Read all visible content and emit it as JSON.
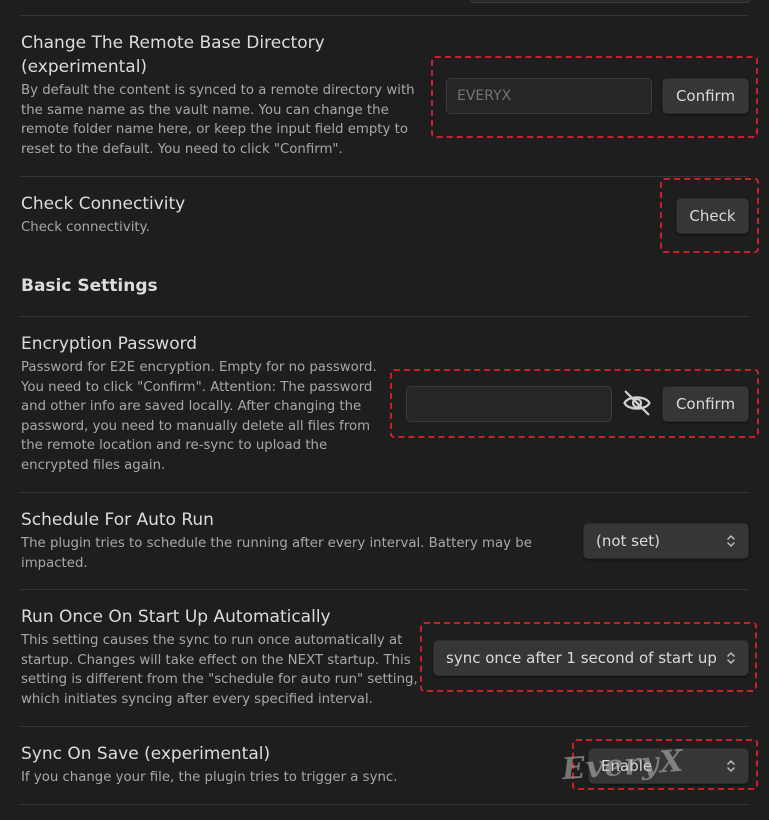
{
  "remote_dir": {
    "title_line1": "Change The Remote Base Directory",
    "title_line2": "(experimental)",
    "desc_lines": [
      "By default the content is synced to a remote directory with",
      "the same name as the vault name. You can change the",
      "remote folder name here, or keep the input field empty to",
      "reset to the default. You need to click \"Confirm\"."
    ],
    "input_placeholder": "EVERYX",
    "confirm_label": "Confirm"
  },
  "connectivity": {
    "title": "Check Connectivity",
    "desc": "Check connectivity.",
    "check_label": "Check"
  },
  "basic_settings": {
    "heading": "Basic Settings"
  },
  "encryption": {
    "title": "Encryption Password",
    "desc_lines": [
      "Password for E2E encryption. Empty for no password.",
      "You need to click \"Confirm\". Attention: The password",
      "and other info are saved locally. After changing the",
      "password, you need to manually delete all files from",
      "the remote location and re-sync to upload the",
      "encrypted files again."
    ],
    "input_value": "",
    "confirm_label": "Confirm",
    "toggle_icon": "eye-off-icon"
  },
  "schedule": {
    "title": "Schedule For Auto Run",
    "desc_lines": [
      "The plugin tries to schedule the running after every interval. Battery may be",
      "impacted."
    ],
    "selected": "(not set)"
  },
  "startup": {
    "title": "Run Once On Start Up Automatically",
    "desc_lines": [
      "This setting causes the sync to run once automatically at",
      "startup. Changes will take effect on the NEXT startup. This",
      "setting is different from the \"schedule for auto run\" setting,",
      "which initiates syncing after every specified interval."
    ],
    "selected": "sync once after 1 second of start up"
  },
  "sync_on_save": {
    "title": "Sync On Save (experimental)",
    "desc": "If you change your file, the plugin tries to trigger a sync.",
    "selected": "Enable"
  },
  "watermark": "EveryX",
  "colors": {
    "highlight": "#c8202a",
    "background": "#1e1e1e",
    "button": "#363636"
  }
}
